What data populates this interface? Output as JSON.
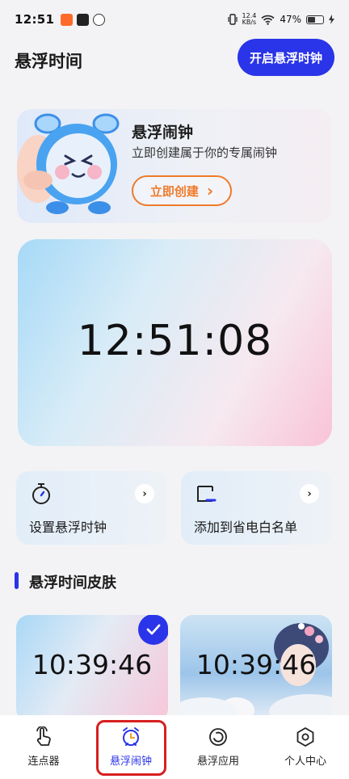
{
  "status_bar": {
    "time": "12:51",
    "net_speed_value": "12.4",
    "net_speed_unit": "KB/s",
    "battery": "47%"
  },
  "header": {
    "title": "悬浮时间",
    "open_button": "开启悬浮时钟"
  },
  "promo": {
    "title": "悬浮闹钟",
    "subtitle": "立即创建属于你的专属闹钟",
    "button": "立即创建",
    "button_arrow": "›"
  },
  "clock": {
    "time": "12:51:08"
  },
  "actions": [
    {
      "label": "设置悬浮时钟",
      "arrow": "›"
    },
    {
      "label": "添加到省电白名单",
      "arrow": "›"
    }
  ],
  "section": {
    "title": "悬浮时间皮肤"
  },
  "skins": [
    {
      "time": "10:39:46",
      "selected": true
    },
    {
      "time": "10:39:46",
      "selected": false
    }
  ],
  "nav": [
    {
      "label": "连点器",
      "icon": "tap-hand-icon"
    },
    {
      "label": "悬浮闹钟",
      "icon": "alarm-clock-icon",
      "active": true
    },
    {
      "label": "悬浮应用",
      "icon": "floating-circle-icon"
    },
    {
      "label": "个人中心",
      "icon": "hexagon-gear-icon"
    }
  ],
  "colors": {
    "accent": "#2a34e8",
    "promo_orange": "#ef7b2a",
    "highlight_red": "#d81f1f"
  }
}
